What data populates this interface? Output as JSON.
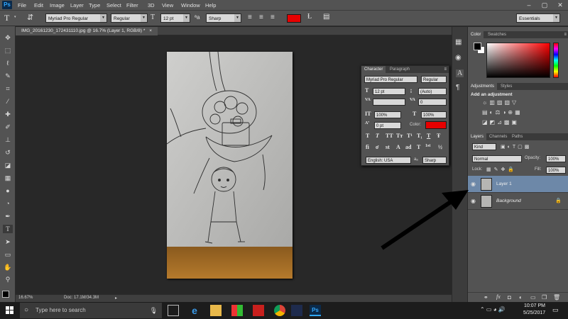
{
  "app": {
    "logo": "Ps"
  },
  "menubar": {
    "items": [
      "File",
      "Edit",
      "Image",
      "Layer",
      "Type",
      "Select",
      "Filter",
      "3D",
      "View",
      "Window",
      "Help"
    ],
    "minimize": "–",
    "maximize": "▢",
    "close": "✕"
  },
  "options": {
    "font_family": "Myriad Pro Regular",
    "font_style": "Regular",
    "font_size": "12 pt",
    "anti_alias": "Sharp",
    "color": "#e60000",
    "workspace": "Essentials"
  },
  "document": {
    "tab_title": "IMG_20161230_172431110.jpg @ 16.7% (Layer 1, RGB/8) *",
    "close": "×"
  },
  "status": {
    "zoom": "16.67%",
    "doc": "Doc: 17.1M/34.3M"
  },
  "character_panel": {
    "tabs": [
      "Character",
      "Paragraph"
    ],
    "font_family": "Myriad Pro Regular",
    "font_style": "Regular",
    "size": "12 pt",
    "leading": "(Auto)",
    "kerning": "",
    "tracking": "0",
    "vscale": "100%",
    "hscale": "100%",
    "baseline": "0 pt",
    "color_label": "Color:",
    "color": "#e60000",
    "style_buttons": [
      "T",
      "T",
      "TT",
      "Tт",
      "T¹",
      "T₁",
      "T",
      "Ŧ"
    ],
    "ot_buttons": [
      "fi",
      "ơ",
      "st",
      "A",
      "ad",
      "T",
      "1st",
      "½"
    ],
    "language": "English: USA",
    "aa": "aₐ",
    "aa_mode": "Sharp"
  },
  "color_panel": {
    "tabs": [
      "Color",
      "Swatches"
    ]
  },
  "adjustments_panel": {
    "tabs": [
      "Adjustments",
      "Styles"
    ],
    "heading": "Add an adjustment"
  },
  "layers_panel": {
    "tabs": [
      "Layers",
      "Channels",
      "Paths"
    ],
    "filter": "Kind",
    "blend_mode": "Normal",
    "opacity_label": "Opacity:",
    "opacity": "100%",
    "lock_label": "Lock:",
    "fill_label": "Fill:",
    "fill": "100%",
    "layers": [
      {
        "name": "Layer 1",
        "selected": true
      },
      {
        "name": "Background",
        "selected": false,
        "locked": true
      }
    ]
  },
  "taskbar": {
    "search_placeholder": "Type here to search",
    "time": "10:07 PM",
    "date": "5/25/2017"
  },
  "colors": {
    "accent_red": "#e60000",
    "selection": "#6d88a8",
    "ps_blue": "#31a8ff"
  }
}
